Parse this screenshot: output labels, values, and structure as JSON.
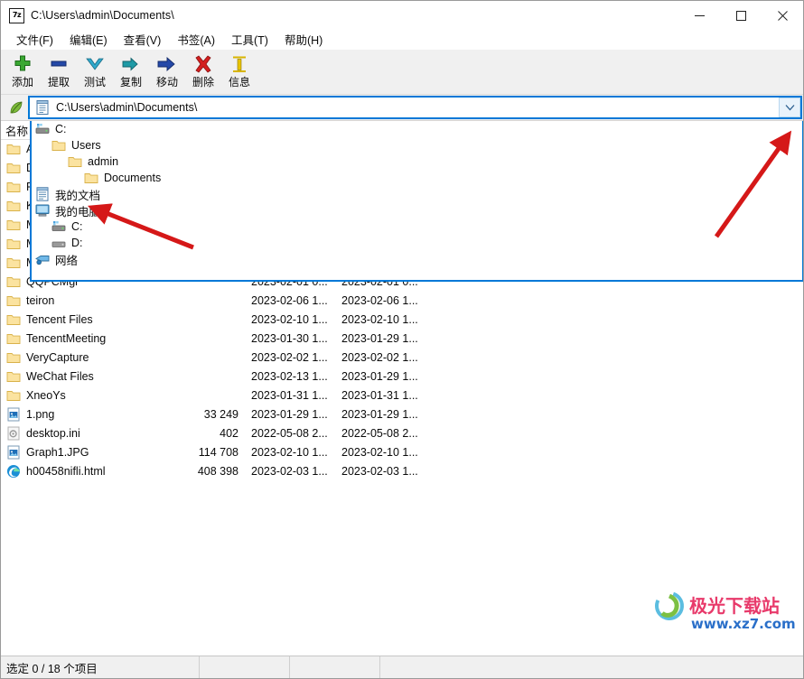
{
  "window": {
    "title": "C:\\Users\\admin\\Documents\\",
    "app_icon": "7z-icon",
    "controls": {
      "minimize": "minimize-icon",
      "maximize": "maximize-icon",
      "close": "close-icon"
    }
  },
  "menubar": {
    "items": [
      {
        "label": "文件(F)"
      },
      {
        "label": "编辑(E)"
      },
      {
        "label": "查看(V)"
      },
      {
        "label": "书签(A)"
      },
      {
        "label": "工具(T)"
      },
      {
        "label": "帮助(H)"
      }
    ]
  },
  "toolbar": {
    "buttons": [
      {
        "label": "添加",
        "icon": "plus-icon",
        "color": "#35a035"
      },
      {
        "label": "提取",
        "icon": "minus-icon",
        "color": "#1b3f9b"
      },
      {
        "label": "测试",
        "icon": "chevron-down-icon",
        "color": "#2aa8c8"
      },
      {
        "label": "复制",
        "icon": "arrow-right-small-icon",
        "color": "#1d9ea8"
      },
      {
        "label": "移动",
        "icon": "arrow-right-icon",
        "color": "#1b3f9b"
      },
      {
        "label": "删除",
        "icon": "cross-icon",
        "color": "#d42020"
      },
      {
        "label": "信息",
        "icon": "info-icon",
        "color": "#d8b500"
      }
    ]
  },
  "addressbar": {
    "value": "C:\\Users\\admin\\Documents\\",
    "icon": "document-icon",
    "dropdown_icon": "chevron-down-icon",
    "focus_color": "#0078d7"
  },
  "dropdown": {
    "open": true,
    "items": [
      {
        "label": "C:",
        "icon": "drive-icon",
        "indent": 0
      },
      {
        "label": "Users",
        "icon": "folder-icon",
        "indent": 1
      },
      {
        "label": "admin",
        "icon": "folder-icon",
        "indent": 2
      },
      {
        "label": "Documents",
        "icon": "folder-icon",
        "indent": 3
      },
      {
        "label": "我的文档",
        "icon": "document-icon",
        "indent": 0
      },
      {
        "label": "我的电脑",
        "icon": "computer-icon",
        "indent": 0
      },
      {
        "label": "C:",
        "icon": "drive-icon",
        "indent": 1
      },
      {
        "label": "D:",
        "icon": "drive-gray-icon",
        "indent": 1
      },
      {
        "label": "网络",
        "icon": "network-icon",
        "indent": 0
      }
    ]
  },
  "filelist": {
    "columns": [
      {
        "label": "名称"
      },
      {
        "label": ""
      },
      {
        "label": ""
      },
      {
        "label": ""
      }
    ],
    "rows": [
      {
        "name": "A",
        "icon": "folder-icon",
        "size": "",
        "modified": "",
        "created": ""
      },
      {
        "name": "D",
        "icon": "folder-icon",
        "size": "",
        "modified": "",
        "created": ""
      },
      {
        "name": "Fo",
        "icon": "folder-icon",
        "size": "",
        "modified": "",
        "created": ""
      },
      {
        "name": "K",
        "icon": "folder-icon",
        "size": "",
        "modified": "",
        "created": ""
      },
      {
        "name": "M",
        "icon": "folder-icon",
        "size": "",
        "modified": "",
        "created": ""
      },
      {
        "name": "M",
        "icon": "folder-icon",
        "size": "",
        "modified": "",
        "created": ""
      },
      {
        "name": "M",
        "icon": "folder-icon",
        "size": "",
        "modified": "",
        "created": ""
      },
      {
        "name": "QQPCMgr",
        "icon": "folder-icon",
        "size": "",
        "modified": "2023-02-01 0...",
        "created": "2023-02-01 0..."
      },
      {
        "name": "teiron",
        "icon": "folder-icon",
        "size": "",
        "modified": "2023-02-06 1...",
        "created": "2023-02-06 1..."
      },
      {
        "name": "Tencent Files",
        "icon": "folder-icon",
        "size": "",
        "modified": "2023-02-10 1...",
        "created": "2023-02-10 1..."
      },
      {
        "name": "TencentMeeting",
        "icon": "folder-icon",
        "size": "",
        "modified": "2023-01-30 1...",
        "created": "2023-01-29 1..."
      },
      {
        "name": "VeryCapture",
        "icon": "folder-icon",
        "size": "",
        "modified": "2023-02-02 1...",
        "created": "2023-02-02 1..."
      },
      {
        "name": "WeChat Files",
        "icon": "folder-icon",
        "size": "",
        "modified": "2023-02-13 1...",
        "created": "2023-01-29 1..."
      },
      {
        "name": "XneoYs",
        "icon": "folder-icon",
        "size": "",
        "modified": "2023-01-31 1...",
        "created": "2023-01-31 1..."
      },
      {
        "name": "1.png",
        "icon": "image-file-icon",
        "size": "33 249",
        "modified": "2023-01-29 1...",
        "created": "2023-01-29 1..."
      },
      {
        "name": "desktop.ini",
        "icon": "ini-file-icon",
        "size": "402",
        "modified": "2022-05-08 2...",
        "created": "2022-05-08 2..."
      },
      {
        "name": "Graph1.JPG",
        "icon": "image-file-icon",
        "size": "114 708",
        "modified": "2023-02-10 1...",
        "created": "2023-02-10 1..."
      },
      {
        "name": "h00458nifli.html",
        "icon": "edge-file-icon",
        "size": "408 398",
        "modified": "2023-02-03 1...",
        "created": "2023-02-03 1..."
      }
    ]
  },
  "statusbar": {
    "selection": "选定 0 / 18 个项目",
    "cell2": "",
    "cell3": "",
    "cell4": ""
  },
  "annotations": {
    "arrow_color": "#d51818",
    "arrows": [
      {
        "name": "arrow-to-dropdown-button",
        "target": "addressbar dropdown chevron"
      },
      {
        "name": "arrow-to-my-documents",
        "target": "我的文档 dropdown item"
      }
    ]
  },
  "watermark": {
    "text_cn": "极光下载站",
    "text_url": "www.xz7.com",
    "color_cn": "#e8396a",
    "color_url": "#2a6fc9"
  }
}
